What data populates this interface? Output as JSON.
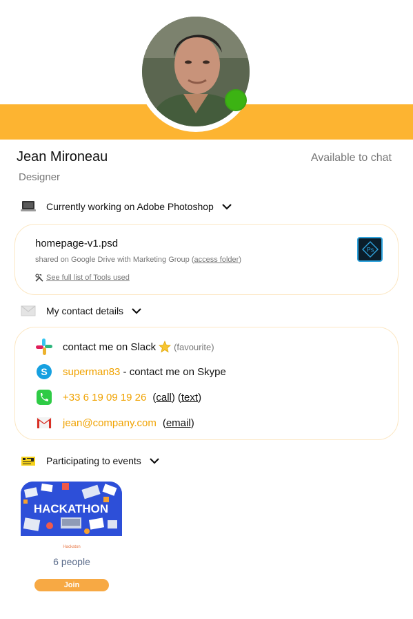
{
  "profile": {
    "name": "Jean Mironeau",
    "role": "Designer",
    "availability": "Available to chat",
    "presence_color": "#3cb313"
  },
  "brand": {
    "banner_color": "#fdb431",
    "accent_color": "#f0a200"
  },
  "working": {
    "title": "Currently working on Adobe Photoshop",
    "icon": "laptop-icon",
    "file_name": "homepage-v1.psd",
    "shared_text": "shared on Google Drive with Marketing Group (",
    "access_link": "access folder",
    "shared_close": ")",
    "tools_link": "See full list of Tools used",
    "app_icon": "photoshop-icon",
    "app_icon_text": "Ps"
  },
  "contact": {
    "title": "My contact details",
    "icon": "envelope-icon",
    "slack": {
      "text": "contact me on Slack",
      "favourite": "(favourite)",
      "icon": "slack-icon"
    },
    "skype": {
      "username": "superman83",
      "text": " - contact me on Skype",
      "icon": "skype-icon"
    },
    "phone": {
      "number": "+33 6 19 09 19 26",
      "call": "call",
      "text": "text",
      "icon": "phone-icon"
    },
    "email": {
      "address": "jean@company.com",
      "action": "email",
      "icon": "gmail-icon"
    }
  },
  "events": {
    "title": "Participating to events",
    "icon": "calendar-icon",
    "items": [
      {
        "image_text": "HACKATHON",
        "label": "Hackaton",
        "people": "6 people",
        "join": "Join"
      }
    ]
  }
}
